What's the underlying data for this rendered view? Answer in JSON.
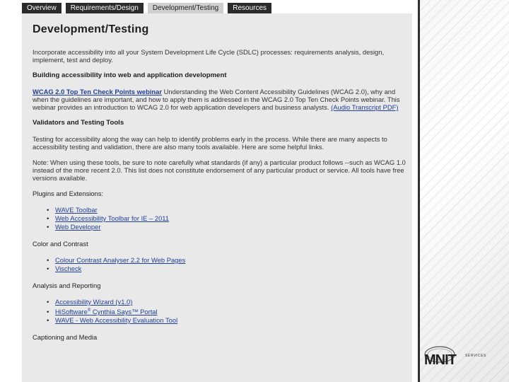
{
  "tabs": [
    {
      "label": "Overview"
    },
    {
      "label": "Requirements/Design"
    },
    {
      "label": "Development/Testing"
    },
    {
      "label": "Resources"
    }
  ],
  "page": {
    "title": "Development/Testing",
    "intro": "Incorporate accessibility into all your System Development Life Cycle (SDLC) processes: requirements analysis, design, implement, test and deploy.",
    "section1": {
      "heading": "Building accessibility into web and application development",
      "link_label": "WCAG 2.0 Top Ten Check Points webinar",
      "text": " Understanding the Web Content Accessibility Guidelines (WCAG 2.0), why and when the guidelines are important, and how to apply them is addressed in the WCAG 2.0 Top Ten Check Points webinar. This webinar provides an introduction to WCAG 2.0 for web application developers and business analysts. ",
      "transcript_label": "(Audio Transcript PDF)"
    },
    "section2": {
      "heading": "Validators and Testing Tools",
      "para1": "Testing for accessibility along the way can help to identify problems early in the process. While there are many aspects to accessibility testing and validation, there are also many tools available. Here are some helpful links.",
      "para2": "Note: When using these tools, be sure to note carefully what standards (if any) a particular product follows --such as WCAG 1.0 instead of the more recent 2.0. This list does not constitute endorsement of any particular product or service. All tools have free versions available."
    },
    "groups": [
      {
        "label": "Plugins and Extensions:",
        "items": [
          "WAVE Toolbar",
          "Web Accessibility Toolbar for IE – 2011",
          "Web Developer"
        ]
      },
      {
        "label": "Color and Contrast",
        "items": [
          "Colour Contrast Analyser 2.2 for Web Pages",
          "Vischeck"
        ]
      },
      {
        "label": "Analysis and Reporting",
        "items": [
          "Accessibility Wizard (v1.0)",
          "HiSoftware",
          "WAVE - Web Accessibility Evaluation Tool"
        ]
      },
      {
        "label": "Captioning and Media",
        "items": []
      }
    ],
    "hisoftware_suffix": " Cynthia Says™ Portal",
    "reg_mark": "®"
  },
  "logo": {
    "word": "MNIT",
    "services": "SERVICES"
  }
}
